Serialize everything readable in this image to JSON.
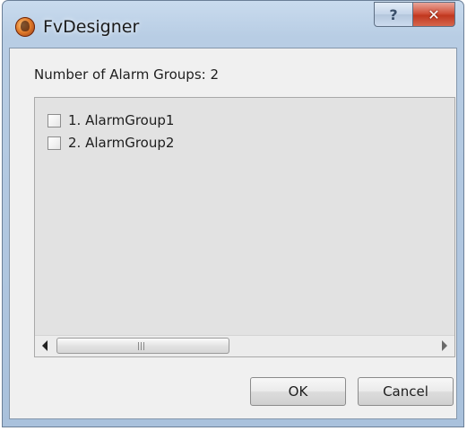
{
  "window": {
    "title": "FvDesigner",
    "help_glyph": "?",
    "close_glyph": "✕"
  },
  "dialog": {
    "count_label": "Number of Alarm Groups: 2",
    "groups": [
      {
        "label": "1. AlarmGroup1",
        "checked": false
      },
      {
        "label": "2. AlarmGroup2",
        "checked": false
      }
    ],
    "scrollbar": {
      "grip_glyph": "III"
    },
    "ok_label": "OK",
    "cancel_label": "Cancel"
  },
  "icons": {
    "app": "fvdesigner-app-icon",
    "help": "help-icon",
    "close": "close-icon",
    "scroll_left": "arrow-left-icon",
    "scroll_right": "arrow-right-icon"
  }
}
